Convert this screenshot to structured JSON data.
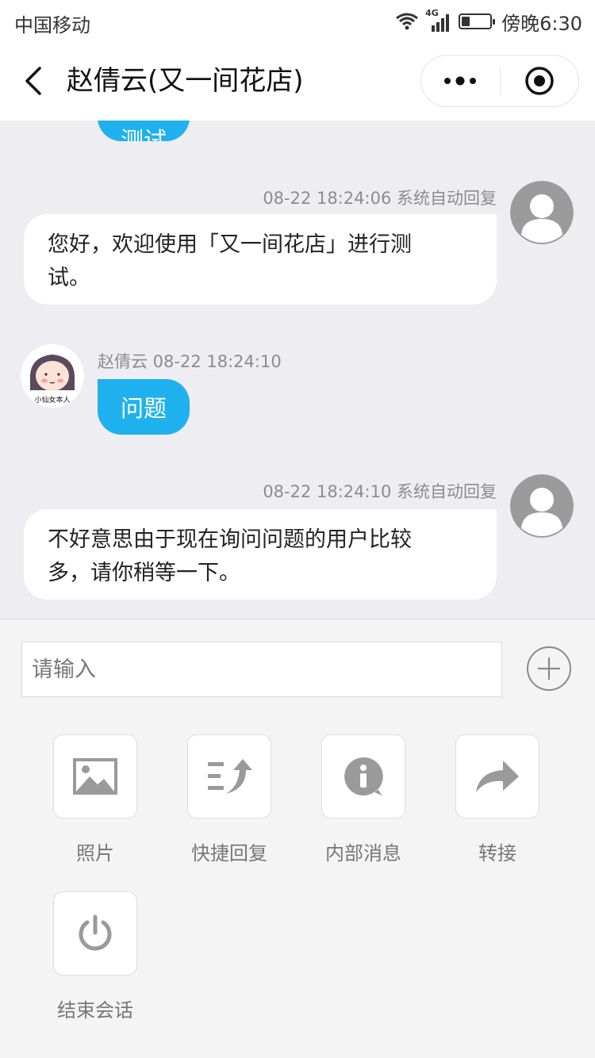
{
  "status_bar": {
    "carrier": "中国移动",
    "network": "4G",
    "time": "傍晚6:30",
    "battery_level": 0.3
  },
  "header": {
    "title": "赵倩云(又一间花店)",
    "back_icon": "chevron-left-icon",
    "more_icon": "more-dots-icon",
    "close_icon": "target-icon"
  },
  "chat": {
    "partial_bubble_text": "测试",
    "messages": [
      {
        "meta": "08-22 18:24:06 系统自动回复",
        "lines": [
          "您好，欢迎使用「又一间花店」进行测",
          "试。"
        ]
      },
      {
        "meta": "赵倩云 08-22 18:24:10",
        "text": "问题",
        "avatar_caption": "小仙女本人"
      },
      {
        "meta": "08-22 18:24:10 系统自动回复",
        "lines": [
          "不好意思由于现在询问问题的用户比较",
          "多，请你稍等一下。"
        ]
      }
    ]
  },
  "input": {
    "placeholder": "请输入",
    "value": ""
  },
  "tools": [
    {
      "label": "照片",
      "icon": "image-icon"
    },
    {
      "label": "快捷回复",
      "icon": "quick-reply-icon"
    },
    {
      "label": "内部消息",
      "icon": "info-bubble-icon"
    },
    {
      "label": "转接",
      "icon": "share-arrow-icon"
    },
    {
      "label": "结束会话",
      "icon": "power-icon"
    }
  ],
  "colors": {
    "accent": "#1fb1ee",
    "chat_bg": "#ededf2",
    "icon_gray": "#999999"
  }
}
